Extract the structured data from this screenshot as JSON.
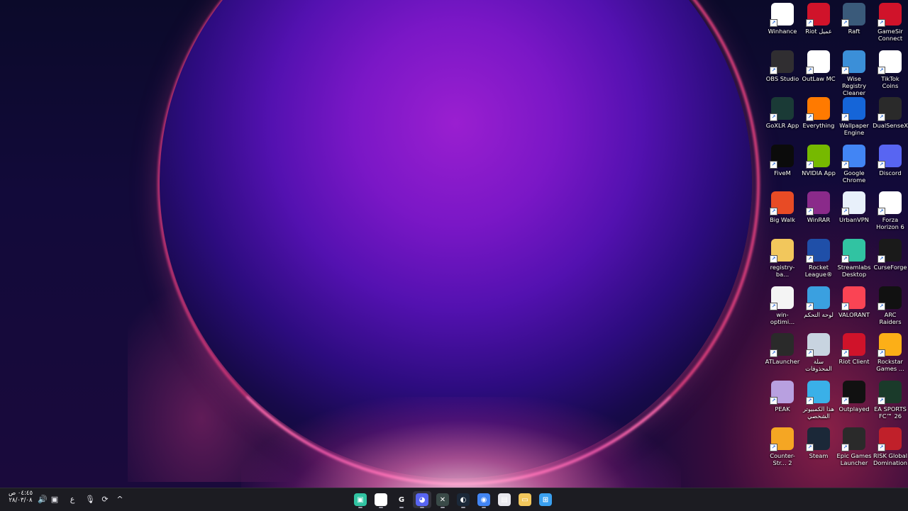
{
  "desktop": {
    "icons": [
      {
        "label": "Winhance",
        "icon": "winhance-icon",
        "color": "#ffffff"
      },
      {
        "label": "Riot عميل",
        "icon": "riot-icon",
        "color": "#d0132a"
      },
      {
        "label": "Raft",
        "icon": "raft-icon",
        "color": "#3a5a7a"
      },
      {
        "label": "GameSir Connect",
        "icon": "gamesir-icon",
        "color": "#d0132a"
      },
      {
        "label": "OBS Studio",
        "icon": "obs-icon",
        "color": "#302e31"
      },
      {
        "label": "OutLaw MC",
        "icon": "file-icon",
        "color": "#ffffff"
      },
      {
        "label": "Wise Registry Cleaner",
        "icon": "wise-registry-icon",
        "color": "#3b8fd8"
      },
      {
        "label": "TikTok Coins",
        "icon": "tiktok-coins-icon",
        "color": "#ffffff"
      },
      {
        "label": "GoXLR App",
        "icon": "goxlr-icon",
        "color": "#1a3a36"
      },
      {
        "label": "Everything",
        "icon": "everything-icon",
        "color": "#ff7a00"
      },
      {
        "label": "Wallpaper Engine",
        "icon": "wallpaper-engine-icon",
        "color": "#1565d8"
      },
      {
        "label": "DualSenseX",
        "icon": "dualsensex-icon",
        "color": "#2a2a2a"
      },
      {
        "label": "FiveM",
        "icon": "fivem-icon",
        "color": "#0b0b0b"
      },
      {
        "label": "NVIDIA App",
        "icon": "nvidia-icon",
        "color": "#76b900"
      },
      {
        "label": "Google Chrome",
        "icon": "chrome-icon",
        "color": "#4285f4"
      },
      {
        "label": "Discord",
        "icon": "discord-icon",
        "color": "#5865f2"
      },
      {
        "label": "Big Walk",
        "icon": "big-walk-icon",
        "color": "#e84b25"
      },
      {
        "label": "WinRAR",
        "icon": "winrar-icon",
        "color": "#8a2a8a"
      },
      {
        "label": "UrbanVPN",
        "icon": "urbanvpn-icon",
        "color": "#e8f0fa"
      },
      {
        "label": "Forza Horizon 6",
        "icon": "forza-icon",
        "color": "#ffffff"
      },
      {
        "label": "registry-ba...",
        "icon": "folder-icon",
        "color": "#f2c75c"
      },
      {
        "label": "Rocket League®",
        "icon": "rocket-league-icon",
        "color": "#1f4fa8"
      },
      {
        "label": "Streamlabs Desktop",
        "icon": "streamlabs-icon",
        "color": "#31c3a2"
      },
      {
        "label": "CurseForge",
        "icon": "curseforge-icon",
        "color": "#1a1a1a"
      },
      {
        "label": "win-optimi...",
        "icon": "text-file-icon",
        "color": "#f4f4f4"
      },
      {
        "label": "لوحة التحكم",
        "icon": "control-panel-icon",
        "color": "#3aa0e0"
      },
      {
        "label": "VALORANT",
        "icon": "valorant-icon",
        "color": "#fa4454"
      },
      {
        "label": "ARC Raiders",
        "icon": "arc-raiders-icon",
        "color": "#111111"
      },
      {
        "label": "ATLauncher",
        "icon": "atlauncher-icon",
        "color": "#2a2a2a"
      },
      {
        "label": "سلة المحذوفات",
        "icon": "recycle-bin-icon",
        "color": "#c8d4e0"
      },
      {
        "label": "Riot Client",
        "icon": "riot-client-icon",
        "color": "#d0132a"
      },
      {
        "label": "Rockstar Games ...",
        "icon": "rockstar-icon",
        "color": "#fcaf17"
      },
      {
        "label": "PEAK",
        "icon": "peak-icon",
        "color": "#b8a0e0"
      },
      {
        "label": "هذا الكمبيوتر الشخصي",
        "icon": "this-pc-icon",
        "color": "#3ab0e8"
      },
      {
        "label": "Outplayed",
        "icon": "outplayed-icon",
        "color": "#111111"
      },
      {
        "label": "EA SPORTS FC™ 26",
        "icon": "ea-fc-icon",
        "color": "#1a3a2a"
      },
      {
        "label": "Counter-Str... 2",
        "icon": "counter-strike-icon",
        "color": "#f5a623"
      },
      {
        "label": "Steam",
        "icon": "steam-icon",
        "color": "#1b2838"
      },
      {
        "label": "Epic Games Launcher",
        "icon": "epic-games-icon",
        "color": "#2a2a2a"
      },
      {
        "label": "RISK Global Domination",
        "icon": "risk-icon",
        "color": "#c0202a"
      }
    ]
  },
  "taskbar": {
    "clock": {
      "time": "٠٤:٤٥ ص",
      "date": "٢٨/٠٣/٠٨"
    },
    "tray": [
      {
        "icon": "speaker-icon",
        "glyph": "🔊"
      },
      {
        "icon": "display-icon",
        "glyph": "▣"
      },
      {
        "icon": "language-indicator",
        "glyph": "ع"
      },
      {
        "icon": "microphone-icon",
        "glyph": "🎙"
      },
      {
        "icon": "sync-icon",
        "glyph": "⟳"
      },
      {
        "icon": "chevron-up-icon",
        "glyph": "^"
      }
    ],
    "apps": [
      {
        "icon": "streamlabs-icon",
        "color": "#31c3a2",
        "glyph": "▣"
      },
      {
        "icon": "gamesir-icon",
        "color": "#ffffff",
        "glyph": "G"
      },
      {
        "icon": "logitech-icon",
        "color": "#1c1c22",
        "glyph": "G"
      },
      {
        "icon": "discord-icon",
        "color": "#5865f2",
        "glyph": "◕"
      },
      {
        "icon": "goxlr-icon",
        "color": "#3a4a48",
        "glyph": "✕"
      },
      {
        "icon": "steam-icon",
        "color": "#1b2838",
        "glyph": "◐"
      },
      {
        "icon": "chrome-icon",
        "color": "#4285f4",
        "glyph": "◉"
      },
      {
        "icon": "store-icon",
        "color": "#e8e8ee",
        "glyph": "▤"
      },
      {
        "icon": "file-explorer-icon",
        "color": "#f2c75c",
        "glyph": "▭"
      },
      {
        "icon": "start-icon",
        "color": "#3aa0f0",
        "glyph": "⊞"
      }
    ]
  }
}
